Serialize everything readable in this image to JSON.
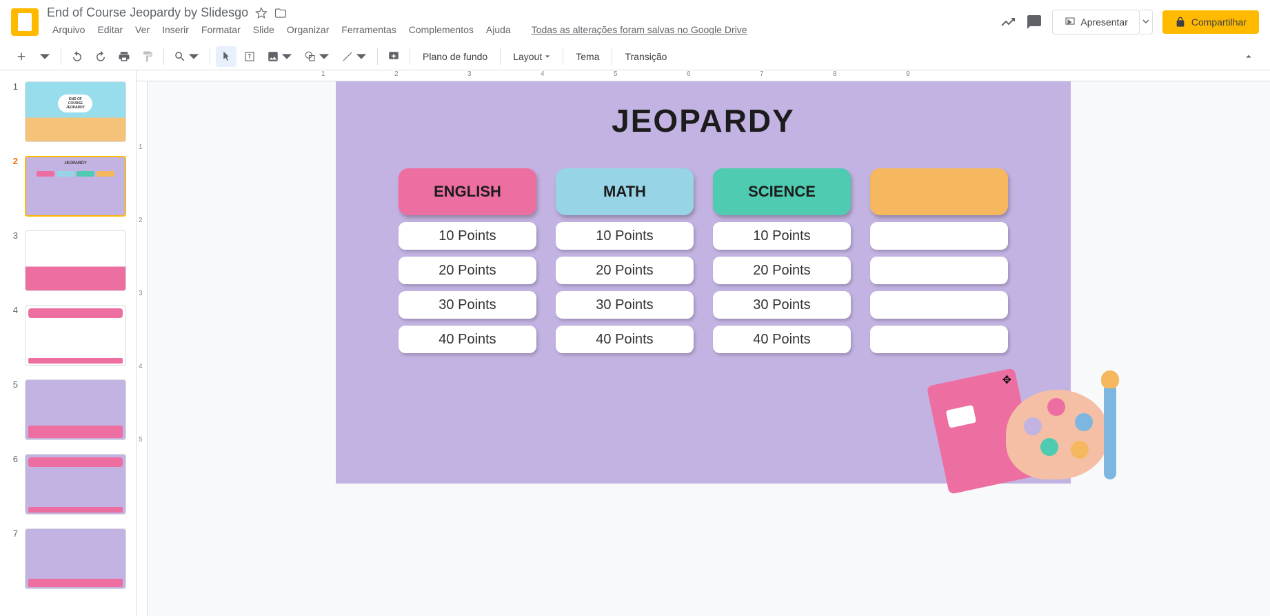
{
  "doc": {
    "title": "End of Course Jeopardy by Slidesgo"
  },
  "menu": {
    "arquivo": "Arquivo",
    "editar": "Editar",
    "ver": "Ver",
    "inserir": "Inserir",
    "formatar": "Formatar",
    "slide": "Slide",
    "organizar": "Organizar",
    "ferramentas": "Ferramentas",
    "complementos": "Complementos",
    "ajuda": "Ajuda",
    "drive_status": "Todas as alterações foram salvas no Google Drive"
  },
  "actions": {
    "present": "Apresentar",
    "share": "Compartilhar"
  },
  "toolbar": {
    "background": "Plano de fundo",
    "layout": "Layout",
    "theme": "Tema",
    "transition": "Transição"
  },
  "slide": {
    "title": "JEOPARDY",
    "columns": [
      {
        "name": "ENGLISH",
        "color": "cat-pink",
        "cells": [
          "10 Points",
          "20 Points",
          "30 Points",
          "40 Points"
        ]
      },
      {
        "name": "MATH",
        "color": "cat-blue",
        "cells": [
          "10 Points",
          "20 Points",
          "30 Points",
          "40 Points"
        ]
      },
      {
        "name": "SCIENCE",
        "color": "cat-green",
        "cells": [
          "10 Points",
          "20 Points",
          "30 Points",
          "40 Points"
        ]
      },
      {
        "name": "",
        "color": "cat-orange",
        "cells": [
          "",
          "",
          "",
          ""
        ]
      }
    ]
  },
  "thumbs": {
    "t1": "END OF\nCOURSE\nJEOPARDY",
    "t2": "JEOPARDY"
  },
  "ruler": {
    "h": [
      "1",
      "2",
      "3",
      "4",
      "5",
      "6",
      "7",
      "8",
      "9"
    ],
    "v": [
      "1",
      "2",
      "3",
      "4",
      "5"
    ]
  }
}
